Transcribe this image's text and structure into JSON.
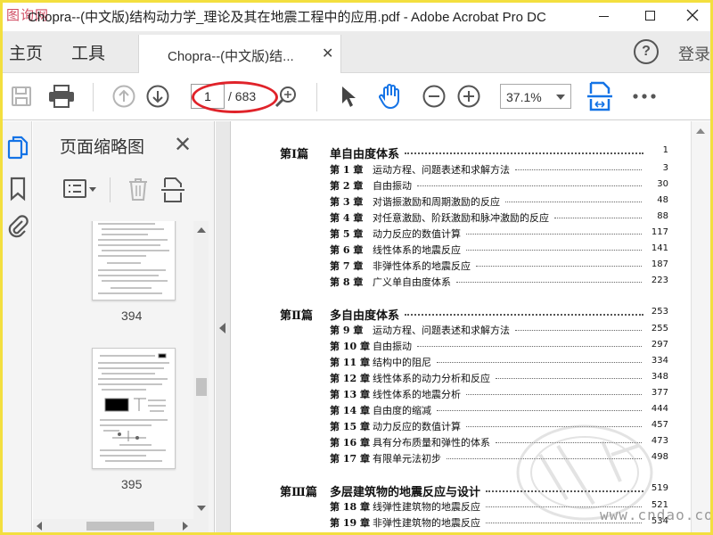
{
  "window": {
    "title": "Chopra--(中文版)结构动力学_理论及其在地震工程中的应用.pdf - Adobe Acrobat Pro DC",
    "watermark_logo": "图询网"
  },
  "menu": {
    "home": "主页",
    "tools": "工具",
    "doc_tab": "Chopra--(中文版)结...",
    "help": "?",
    "login": "登录"
  },
  "toolbar": {
    "current_page": "1",
    "page_total": "/ 683",
    "zoom": "37.1%",
    "icons": [
      "save-icon",
      "print-icon",
      "page-up-icon",
      "page-down-icon",
      "zoom-search-icon",
      "select-cursor-icon",
      "hand-icon",
      "zoom-out-icon",
      "zoom-in-icon",
      "fit-page-icon",
      "more-icon"
    ]
  },
  "annotation": {
    "color": "#e0232a"
  },
  "thumbnails": {
    "title": "页面缩略图",
    "pages": [
      {
        "label": "394"
      },
      {
        "label": "395"
      }
    ]
  },
  "toc": {
    "parts": [
      {
        "num": "第Ⅰ篇",
        "title": "单自由度体系",
        "page": "1",
        "chapters": [
          {
            "num": "第 1 章",
            "title": "运动方程、问题表述和求解方法",
            "page": "3"
          },
          {
            "num": "第 2 章",
            "title": "自由振动",
            "page": "30"
          },
          {
            "num": "第 3 章",
            "title": "对谐振激励和周期激励的反应",
            "page": "48"
          },
          {
            "num": "第 4 章",
            "title": "对任意激励、阶跃激励和脉冲激励的反应",
            "page": "88"
          },
          {
            "num": "第 5 章",
            "title": "动力反应的数值计算",
            "page": "117"
          },
          {
            "num": "第 6 章",
            "title": "线性体系的地震反应",
            "page": "141"
          },
          {
            "num": "第 7 章",
            "title": "非弹性体系的地震反应",
            "page": "187"
          },
          {
            "num": "第 8 章",
            "title": "广义单自由度体系",
            "page": "223"
          }
        ]
      },
      {
        "num": "第Ⅱ篇",
        "title": "多自由度体系",
        "page": "253",
        "chapters": [
          {
            "num": "第 9 章",
            "title": "运动方程、问题表述和求解方法",
            "page": "255"
          },
          {
            "num": "第 10 章",
            "title": "自由振动",
            "page": "297"
          },
          {
            "num": "第 11 章",
            "title": "结构中的阻尼",
            "page": "334"
          },
          {
            "num": "第 12 章",
            "title": "线性体系的动力分析和反应",
            "page": "348"
          },
          {
            "num": "第 13 章",
            "title": "线性体系的地震分析",
            "page": "377"
          },
          {
            "num": "第 14 章",
            "title": "自由度的缩减",
            "page": "444"
          },
          {
            "num": "第 15 章",
            "title": "动力反应的数值计算",
            "page": "457"
          },
          {
            "num": "第 16 章",
            "title": "具有分布质量和弹性的体系",
            "page": "473"
          },
          {
            "num": "第 17 章",
            "title": "有限单元法初步",
            "page": "498"
          }
        ]
      },
      {
        "num": "第Ⅲ篇",
        "title": "多层建筑物的地震反应与设计",
        "page": "519",
        "chapters": [
          {
            "num": "第 18 章",
            "title": "线弹性建筑物的地震反应",
            "page": "521"
          },
          {
            "num": "第 19 章",
            "title": "非弹性建筑物的地震反应",
            "page": "534"
          }
        ]
      }
    ]
  },
  "watermarks": {
    "site": "www.cndao.com"
  }
}
